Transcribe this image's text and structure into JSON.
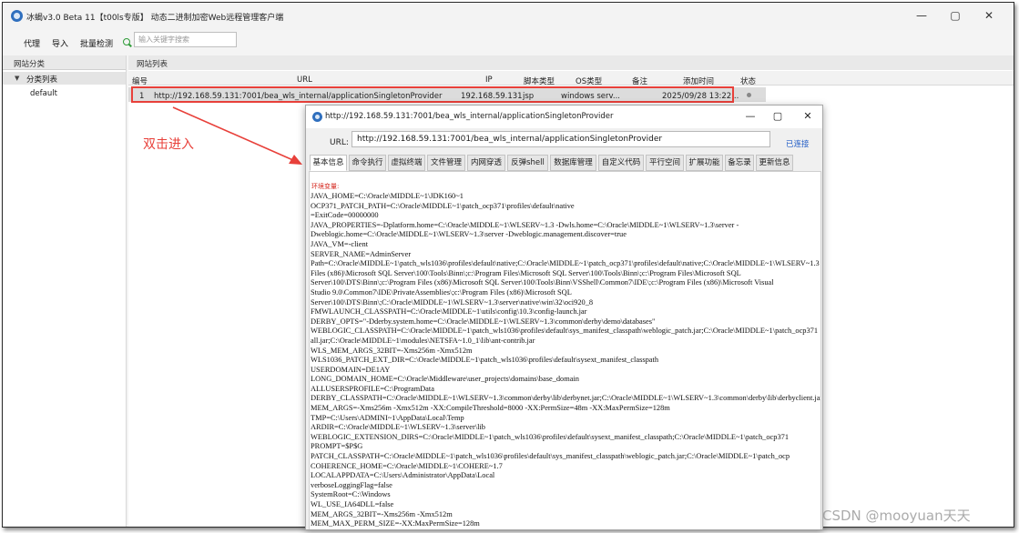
{
  "main": {
    "title": "冰蝎v3.0 Beta 11【t00ls专版】 动态二进制加密Web远程管理客户端",
    "window_controls": {
      "minimize": "—",
      "maximize": "▢",
      "close": "✕"
    }
  },
  "menu": {
    "items": [
      "代理",
      "导入",
      "批量检测"
    ]
  },
  "search": {
    "placeholder": "输入关键字搜索",
    "icon": "search-icon"
  },
  "left_panel": {
    "header": "网站分类",
    "tree": [
      {
        "label": "分类列表",
        "expanded": true,
        "arrow": "▼"
      },
      {
        "label": "default"
      }
    ]
  },
  "site_list": {
    "header": "网站列表",
    "columns": [
      "编号",
      "URL",
      "IP",
      "脚本类型",
      "OS类型",
      "备注",
      "添加时间",
      "状态"
    ],
    "rows": [
      {
        "id": "1",
        "url": "http://192.168.59.131:7001/bea_wls_internal/applicationSingletonProvider",
        "ip": "192.168.59.131",
        "script_type": "jsp",
        "os": "windows serv...",
        "note": "",
        "added": "2025/09/28 13:22...",
        "status": "•"
      }
    ]
  },
  "annotation": {
    "text": "双击进入",
    "color": "#e8403a"
  },
  "popup": {
    "title": "http://192.168.59.131:7001/bea_wls_internal/applicationSingletonProvider",
    "controls": {
      "minimize": "—",
      "maximize": "▢",
      "close": "✕"
    },
    "url_label": "URL:",
    "url_value": "http://192.168.59.131:7001/bea_wls_internal/applicationSingletonProvider",
    "connection_status": "已连接",
    "tabs": [
      "基本信息",
      "命令执行",
      "虚拟终端",
      "文件管理",
      "内网穿透",
      "反弹shell",
      "数据库管理",
      "自定义代码",
      "平行空间",
      "扩展功能",
      "备忘录",
      "更新信息"
    ],
    "active_tab": "基本信息",
    "env_title": "环境变量:",
    "env_lines": [
      "JAVA_HOME=C:\\Oracle\\MIDDLE~1\\JDK160~1",
      "OCP371_PATCH_PATH=C:\\Oracle\\MIDDLE~1\\patch_ocp371\\profiles\\default\\native",
      "=ExitCode=00000000",
      "JAVA_PROPERTIES=-Dplatform.home=C:\\Oracle\\MIDDLE~1\\WLSERV~1.3 -Dwls.home=C:\\Oracle\\MIDDLE~1\\WLSERV~1.3\\server -",
      "Dweblogic.home=C:\\Oracle\\MIDDLE~1\\WLSERV~1.3\\server -Dweblogic.management.discover=true",
      "JAVA_VM=-client",
      "SERVER_NAME=AdminServer",
      "Path=C:\\Oracle\\MIDDLE~1\\patch_wls1036\\profiles\\default\\native;C:\\Oracle\\MIDDLE~1\\patch_ocp371\\profiles\\default\\native;C:\\Oracle\\MIDDLE~1\\WLSERV~1.3",
      "Files (x86)\\Microsoft SQL Server\\100\\Tools\\Binn\\;c:\\Program Files\\Microsoft SQL Server\\100\\Tools\\Binn\\;c:\\Program Files\\Microsoft SQL",
      "Server\\100\\DTS\\Binn\\;c:\\Program Files (x86)\\Microsoft SQL Server\\100\\Tools\\Binn\\VSShell\\Common7\\IDE\\;c:\\Program Files (x86)\\Microsoft Visual",
      "Studio 9.0\\Common7\\IDE\\PrivateAssemblies\\;c:\\Program Files (x86)\\Microsoft SQL",
      "Server\\100\\DTS\\Binn\\;C:\\Oracle\\MIDDLE~1\\WLSERV~1.3\\server\\native\\win\\32\\oci920_8",
      "FMWLAUNCH_CLASSPATH=C:\\Oracle\\MIDDLE~1\\utils\\config\\10.3\\config-launch.jar",
      "DERBY_OPTS=\"-Dderby.system.home=C:\\Oracle\\MIDDLE~1\\WLSERV~1.3\\common\\derby\\demo\\databases\"",
      "WEBLOGIC_CLASSPATH=C:\\Oracle\\MIDDLE~1\\patch_wls1036\\profiles\\default\\sys_manifest_classpath\\weblogic_patch.jar;C:\\Oracle\\MIDDLE~1\\patch_ocp371",
      "all.jar;C:\\Oracle\\MIDDLE~1\\modules\\NETSFA~1.0_1\\lib\\ant-contrib.jar",
      "WLS_MEM_ARGS_32BIT=-Xms256m -Xmx512m",
      "WLS1036_PATCH_EXT_DIR=C:\\Oracle\\MIDDLE~1\\patch_wls1036\\profiles\\default\\sysext_manifest_classpath",
      "USERDOMAIN=DE1AY",
      "LONG_DOMAIN_HOME=C:\\Oracle\\Middleware\\user_projects\\domains\\base_domain",
      "ALLUSERSPROFILE=C:\\ProgramData",
      "DERBY_CLASSPATH=C:\\Oracle\\MIDDLE~1\\WLSERV~1.3\\common\\derby\\lib\\derbynet.jar;C:\\Oracle\\MIDDLE~1\\WLSERV~1.3\\common\\derby\\lib\\derbyclient.jar",
      "MEM_ARGS=-Xms256m -Xmx512m -XX:CompileThreshold=8000 -XX:PermSize=48m -XX:MaxPermSize=128m",
      "TMP=C:\\Users\\ADMINI~1\\AppData\\Local\\Temp",
      "ARDIR=C:\\Oracle\\MIDDLE~1\\WLSERV~1.3\\server\\lib",
      "WEBLOGIC_EXTENSION_DIRS=C:\\Oracle\\MIDDLE~1\\patch_wls1036\\profiles\\default\\sysext_manifest_classpath;C:\\Oracle\\MIDDLE~1\\patch_ocp371",
      "PROMPT=$P$G",
      "PATCH_CLASSPATH=C:\\Oracle\\MIDDLE~1\\patch_wls1036\\profiles\\default\\sys_manifest_classpath\\weblogic_patch.jar;C:\\Oracle\\MIDDLE~1\\patch_ocp",
      "COHERENCE_HOME=C:\\Oracle\\MIDDLE~1\\COHERE~1.7",
      "LOCALAPPDATA=C:\\Users\\Administrator\\AppData\\Local",
      "verboseLoggingFlag=false",
      "SystemRoot=C:\\Windows",
      "WL_USE_IA64DLL=false",
      "MEM_ARGS_32BIT=-Xms256m -Xmx512m",
      "MEM_MAX_PERM_SIZE=-XX:MaxPermSize=128m"
    ]
  },
  "watermark": "CSDN @mooyuan天天"
}
